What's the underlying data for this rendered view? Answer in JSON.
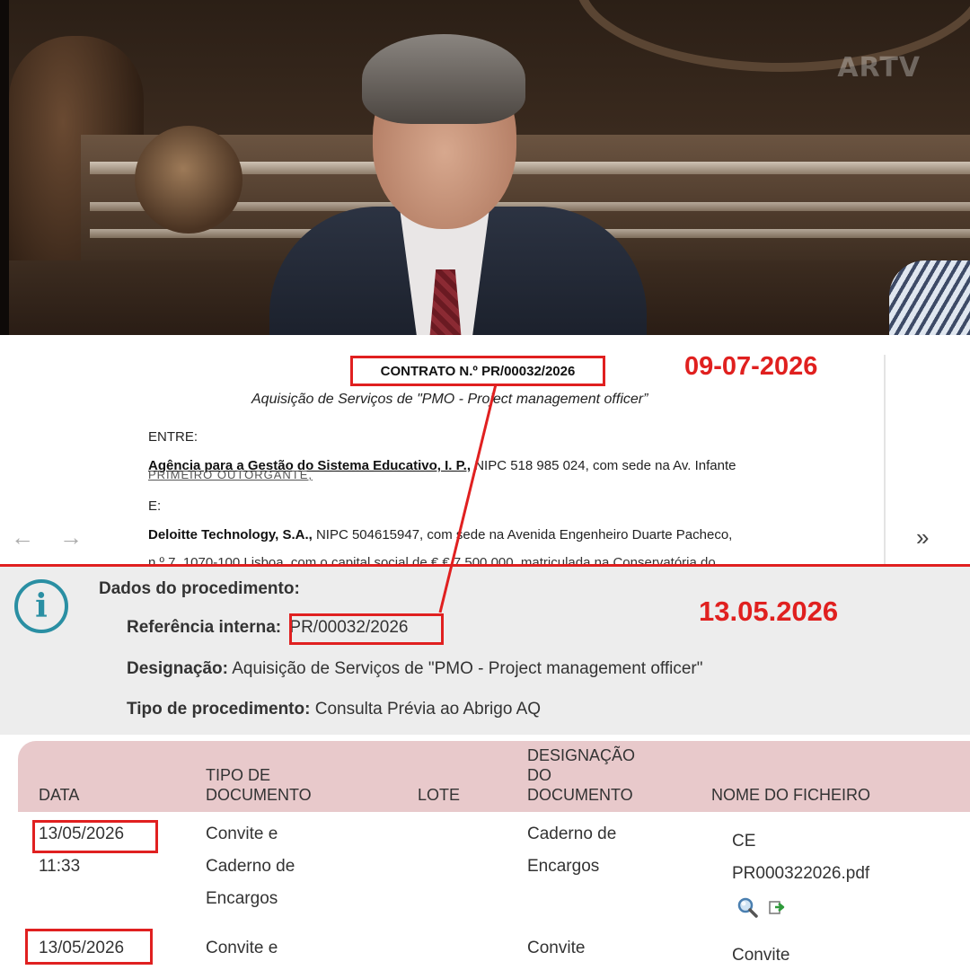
{
  "video": {
    "logo": "ARTV"
  },
  "contract": {
    "title": "CONTRATO N.º PR/00032/2026",
    "annotation_date": "09-07-2026",
    "subtitle": "Aquisição de Serviços de \"PMO - Project management officer”",
    "entre": "ENTRE:",
    "party1_name": "Agência para a Gestão do Sistema Educativo, I. P.,",
    "party1_rest": " NIPC 518 985 024, com sede na Av. Infante",
    "party1_overlap": "PRIMEIRO OUTORGANTE,",
    "e": "E:",
    "party2_name": "Deloitte Technology, S.A.,",
    "party2_rest": " NIPC 504615947, com sede na Avenida Engenheiro Duarte Pacheco,",
    "party2_cut": "n.º 7, 1070-100 Lisboa, com o capital social de € € 7 500 000, matriculada na Conservatória do"
  },
  "nav": {
    "prev": "←",
    "next": "→",
    "next_double": "»"
  },
  "procedure": {
    "info_icon": "i",
    "heading": "Dados do procedimento:",
    "ref_label": "Referência interna:",
    "ref_value": "PR/00032/2026",
    "annotation_date": "13.05.2026",
    "designation_label": "Designação:",
    "designation_value": "Aquisição de Serviços de \"PMO - Project management officer\"",
    "type_label": "Tipo de procedimento:",
    "type_value": "Consulta Prévia ao Abrigo AQ"
  },
  "table": {
    "headers": {
      "date": "DATA",
      "doc_type_1": "TIPO DE",
      "doc_type_2": "DOCUMENTO",
      "lot": "LOTE",
      "designation_1": "DESIGNAÇÃO",
      "designation_2": "DO",
      "designation_3": "DOCUMENTO",
      "filename": "NOME DO FICHEIRO"
    },
    "rows": [
      {
        "date": "13/05/2026",
        "time": "11:33",
        "doc_type": [
          "Convite e",
          "Caderno de",
          "Encargos"
        ],
        "designation": [
          "Caderno de",
          "Encargos"
        ],
        "filename": [
          "CE",
          "PR000322026.pdf"
        ]
      },
      {
        "date": "13/05/2026",
        "doc_type": [
          "Convite e"
        ],
        "designation": [
          "Convite"
        ],
        "filename": [
          "Convite"
        ]
      }
    ]
  },
  "colors": {
    "annotation_red": "#e02020",
    "info_teal": "#2a8fa3",
    "table_header": "#e8c9cb",
    "panel_gray": "#ededed"
  }
}
